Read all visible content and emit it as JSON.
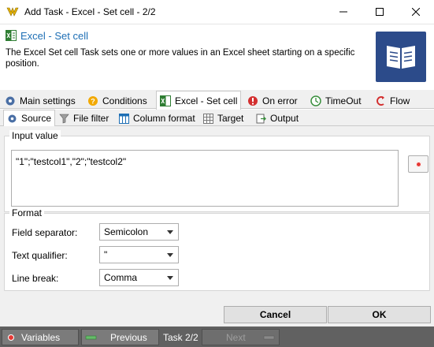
{
  "window": {
    "title": "Add Task - Excel - Set cell - 2/2",
    "minimize": "—",
    "maximize": "☐",
    "close": "✕"
  },
  "header": {
    "task_title": "Excel - Set cell",
    "description": "The Excel Set cell Task sets one or more values in an Excel sheet starting on a specific position."
  },
  "main_tabs": [
    {
      "label": "Main settings",
      "icon": "gear-icon"
    },
    {
      "label": "Conditions",
      "icon": "question-icon"
    },
    {
      "label": "Excel - Set cell",
      "icon": "excel-icon"
    },
    {
      "label": "On error",
      "icon": "error-icon"
    },
    {
      "label": "TimeOut",
      "icon": "timeout-icon"
    },
    {
      "label": "Flow",
      "icon": "flow-icon"
    }
  ],
  "sub_tabs": [
    {
      "label": "Source",
      "icon": "gear-icon"
    },
    {
      "label": "File filter",
      "icon": "filter-icon"
    },
    {
      "label": "Column format",
      "icon": "column-icon"
    },
    {
      "label": "Target",
      "icon": "table-icon"
    },
    {
      "label": "Output",
      "icon": "output-icon"
    }
  ],
  "input_value": {
    "legend": "Input value",
    "value": "\"1\";\"testcol1\",\"2\";\"testcol2\""
  },
  "format": {
    "legend": "Format",
    "fields": [
      {
        "label": "Field separator:",
        "value": "Semicolon"
      },
      {
        "label": "Text qualifier:",
        "value": "\""
      },
      {
        "label": "Line break:",
        "value": "Comma"
      }
    ]
  },
  "buttons": {
    "cancel": "Cancel",
    "ok": "OK"
  },
  "statusbar": {
    "variables": "Variables",
    "previous": "Previous",
    "task_counter": "Task 2/2",
    "next": "Next"
  },
  "colors": {
    "title_blue": "#1e6fb5",
    "icon_bg": "#2c4b8a",
    "status_bg": "#616161",
    "record_red": "#e53935"
  }
}
